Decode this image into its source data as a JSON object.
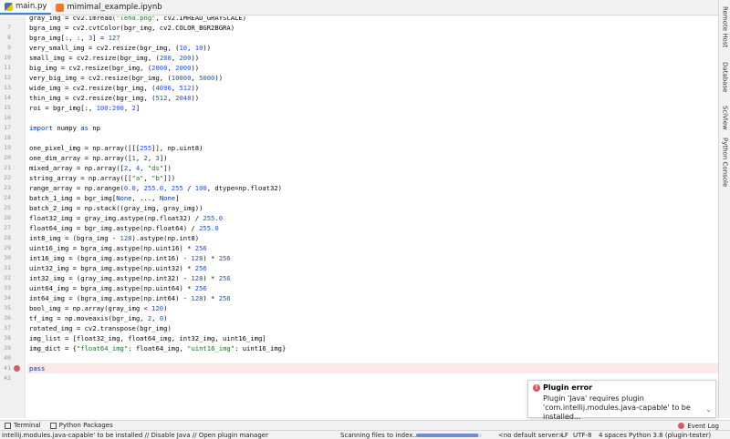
{
  "tabs": [
    {
      "label": "main.py",
      "icon": "python-file-icon",
      "active": true
    },
    {
      "label": "mimimal_example.ipynb",
      "icon": "jupyter-notebook-icon",
      "active": false
    }
  ],
  "right_tools": [
    {
      "label": "Remote Host",
      "icon": "remote-host-icon"
    },
    {
      "label": "Database",
      "icon": "database-icon"
    },
    {
      "label": "SciView",
      "icon": "sciview-icon"
    },
    {
      "label": "Python Console",
      "icon": "python-console-icon"
    }
  ],
  "code_lines": [
    {
      "n": "",
      "html": "gray_img = cv2.imread(<span class='str'>\"lena.png\"</span>, cv2.IMREAD_GRAYSCALE)"
    },
    {
      "n": "7",
      "html": "bgra_img = cv2.cvtColor(bgr_img, cv2.COLOR_BGR2BGRA)"
    },
    {
      "n": "8",
      "html": "bgra_img[:, :, <span class='num'>3</span>] = <span class='num'>127</span>"
    },
    {
      "n": "9",
      "html": "very_small_img = cv2.resize(bgr_img, (<span class='num'>10</span>, <span class='num'>10</span>))"
    },
    {
      "n": "10",
      "html": "small_img = cv2.resize(bgr_img, (<span class='num'>200</span>, <span class='num'>200</span>))"
    },
    {
      "n": "11",
      "html": "big_img = cv2.resize(bgr_img, (<span class='num'>2000</span>, <span class='num'>2000</span>))"
    },
    {
      "n": "12",
      "html": "very_big_img = cv2.resize(bgr_img, (<span class='num'>10000</span>, <span class='num'>5000</span>))"
    },
    {
      "n": "13",
      "html": "wide_img = cv2.resize(bgr_img, (<span class='num'>4096</span>, <span class='num'>512</span>))"
    },
    {
      "n": "14",
      "html": "thin_img = cv2.resize(bgr_img, (<span class='num'>512</span>, <span class='num'>2048</span>))"
    },
    {
      "n": "15",
      "html": "roi = bgr_img[:, <span class='num'>100</span>:<span class='num'>200</span>, <span class='num'>2</span>]"
    },
    {
      "n": "16",
      "html": ""
    },
    {
      "n": "17",
      "html": "<span class='kw'>import</span> numpy <span class='kw'>as</span> np"
    },
    {
      "n": "18",
      "html": ""
    },
    {
      "n": "19",
      "html": "one_pixel_img = np.array([[[<span class='num'>255</span>]], np.uint8)"
    },
    {
      "n": "20",
      "html": "one_dim_array = np.array([<span class='num'>1</span>, <span class='num'>2</span>, <span class='num'>3</span>])"
    },
    {
      "n": "21",
      "html": "mixed_array = np.array([<span class='num'>2</span>, <span class='num'>4</span>, <span class='str'>\"ds\"</span>])"
    },
    {
      "n": "22",
      "html": "string_array = np.array([[<span class='str'>\"a\"</span>, <span class='str'>\"b\"</span>]])"
    },
    {
      "n": "23",
      "html": "range_array = np.arange(<span class='num'>0.0</span>, <span class='num'>255.0</span>, <span class='num'>255</span> / <span class='num'>100</span>, dtype=np.float32)"
    },
    {
      "n": "24",
      "html": "batch_1_img = bgr_img[<span class='kw'>None</span>, ..., <span class='kw'>None</span>]"
    },
    {
      "n": "25",
      "html": "batch_2_img = np.stack((gray_img, gray_img))"
    },
    {
      "n": "26",
      "html": "float32_img = gray_img.astype(np.float32) / <span class='num'>255.0</span>"
    },
    {
      "n": "27",
      "html": "float64_img = bgr_img.astype(np.float64) / <span class='num'>255.0</span>"
    },
    {
      "n": "28",
      "html": "int8_img = (bgra_img - <span class='num'>128</span>).astype(np.int8)"
    },
    {
      "n": "29",
      "html": "uint16_img = bgra_img.astype(np.uint16) * <span class='num'>256</span>"
    },
    {
      "n": "30",
      "html": "int16_img = (bgra_img.astype(np.int16) - <span class='num'>128</span>) * <span class='num'>256</span>"
    },
    {
      "n": "31",
      "html": "uint32_img = bgra_img.astype(np.uint32) * <span class='num'>256</span>"
    },
    {
      "n": "32",
      "html": "int32_img = (gray_img.astype(np.int32) - <span class='num'>128</span>) * <span class='num'>256</span>"
    },
    {
      "n": "33",
      "html": "uint64_img = bgra_img.astype(np.uint64) * <span class='num'>256</span>"
    },
    {
      "n": "34",
      "html": "int64_img = (bgra_img.astype(np.int64) - <span class='num'>128</span>) * <span class='num'>256</span>"
    },
    {
      "n": "35",
      "html": "bool_img = np.array(gray_img &lt; <span class='num'>120</span>)"
    },
    {
      "n": "36",
      "html": "tf_img = np.moveaxis(bgr_img, <span class='num'>2</span>, <span class='num'>0</span>)"
    },
    {
      "n": "37",
      "html": "rotated_img = cv2.transpose(bgr_img)"
    },
    {
      "n": "38",
      "html": "img_list = [float32_img, float64_img, int32_img, uint16_img]"
    },
    {
      "n": "39",
      "html": "img_dict = {<span class='str'>\"float64_img\"</span>: float64_img, <span class='str'>\"uint16_img\"</span>: uint16_img}"
    },
    {
      "n": "40",
      "html": ""
    },
    {
      "n": "41",
      "html": "<span class='kw'>pass</span>",
      "current": true,
      "breakpoint": true
    },
    {
      "n": "42",
      "html": ""
    }
  ],
  "notification": {
    "title": "Plugin error",
    "message": "Plugin 'Java' requires plugin 'com.intellij.modules.java-capable' to be installed..."
  },
  "bottom_tools": {
    "terminal": "Terminal",
    "python_packages": "Python Packages",
    "event_log": "Event Log"
  },
  "status": {
    "message": "intellij.modules.java-capable' to be installed // Disable Java // Open plugin manager",
    "indexing": "Scanning files to index...",
    "indexing_progress": 0.95,
    "server": "<no default server>",
    "line_sep": "LF",
    "encoding": "UTF-8",
    "indent": "4 spaces",
    "interpreter": "Python 3.8 (plugin-tester)"
  }
}
